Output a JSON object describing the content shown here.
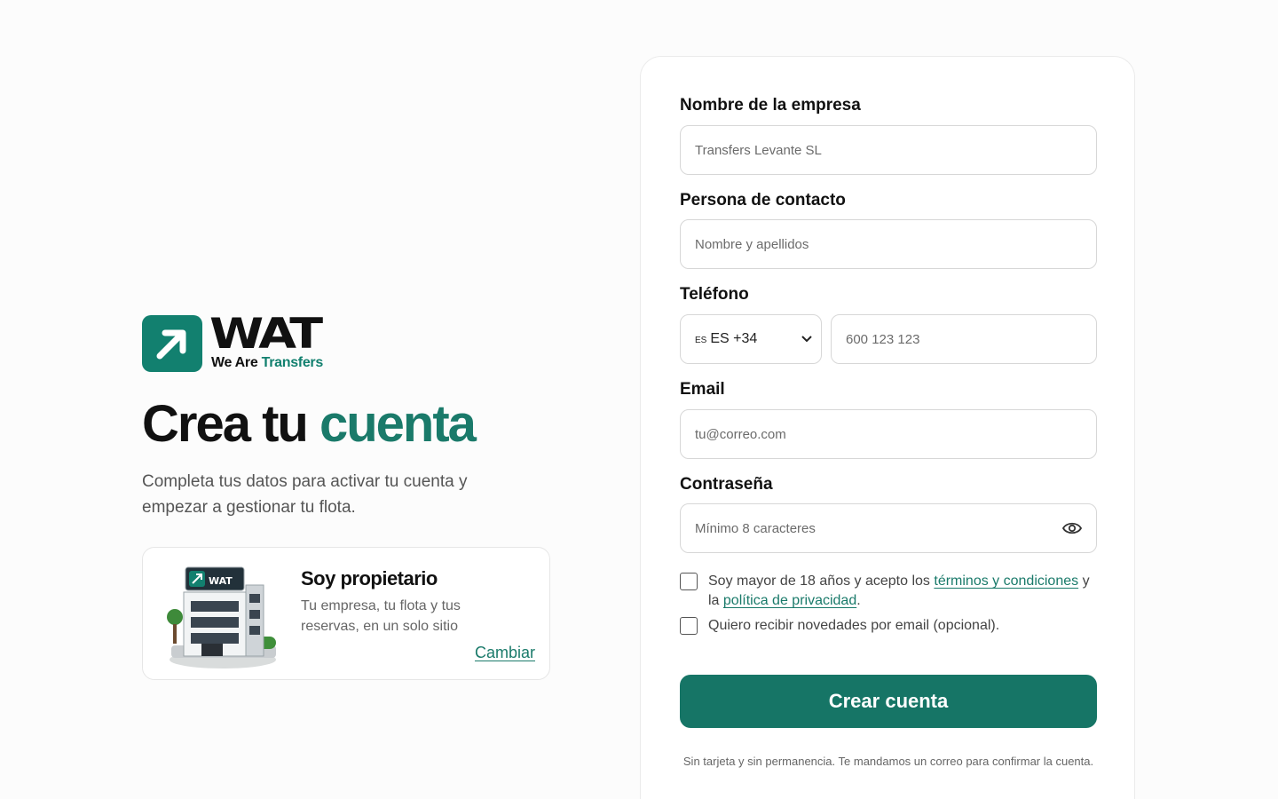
{
  "brand": {
    "name": "WAT",
    "tagline_a": "We Are",
    "tagline_b": "Transfers",
    "accent_color": "#12806f"
  },
  "hero": {
    "title_part1": "Crea tu",
    "title_part2": "cuenta",
    "lead": "Completa tus datos para activar tu cuenta y empezar a gestionar tu flota."
  },
  "owner_card": {
    "badge": "WAT",
    "title": "Soy propietario",
    "description": "Tu empresa, tu flota y tus reservas, en un solo sitio",
    "change_link": "Cambiar"
  },
  "form": {
    "company": {
      "label": "Nombre de la empresa",
      "placeholder": "Transfers Levante SL"
    },
    "contact": {
      "label": "Persona de contacto",
      "placeholder": "Nombre y apellidos"
    },
    "phone": {
      "label": "Teléfono",
      "country_flag": "ES",
      "country_value": "ES +34",
      "placeholder": "600 123 123"
    },
    "email": {
      "label": "Email",
      "placeholder": "tu@correo.com"
    },
    "password": {
      "label": "Contraseña",
      "placeholder": "Mínimo 8 caracteres",
      "toggle_icon": "eye-icon"
    },
    "terms": {
      "text_before": "Soy mayor de 18 años y acepto los ",
      "terms_link": "términos y condiciones",
      "text_middle": " y la ",
      "privacy_link": "política de privacidad",
      "text_after": ".",
      "checked": false
    },
    "newsletter": {
      "text": "Quiero recibir novedades por email (opcional).",
      "checked": false
    },
    "submit_label": "Crear cuenta",
    "footnote": "Sin tarjeta y sin permanencia. Te mandamos un correo para confirmar la cuenta."
  }
}
